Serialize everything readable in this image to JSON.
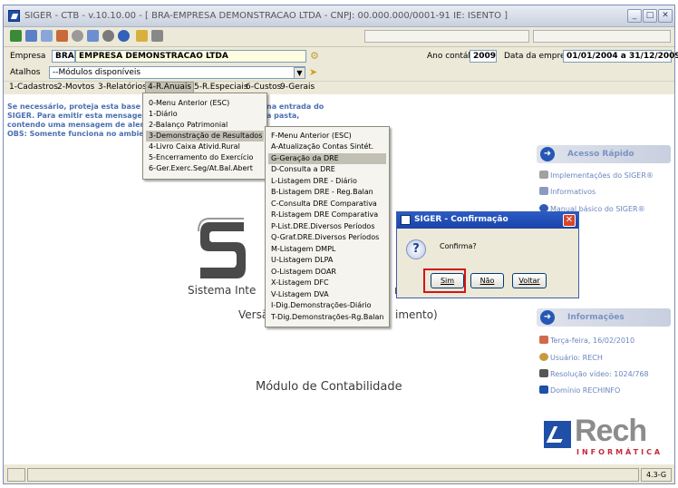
{
  "window": {
    "title": "SIGER - CTB - v.10.10.00 - [ BRA-EMPRESA DEMONSTRACAO LTDA - CNPJ: 00.000.000/0001-91 IE: ISENTO ]"
  },
  "empresa": {
    "label": "Empresa",
    "code": "BRA",
    "name": "EMPRESA DEMONSTRACAO LTDA",
    "ano_label": "Ano contábil",
    "ano_value": "2009",
    "data_label": "Data da empresa",
    "data_value": "01/01/2004 a 31/12/2009"
  },
  "atalhos": {
    "label": "Atalhos",
    "value": "--Módulos disponíveis"
  },
  "menubar": [
    "1-Cadastros",
    "2-Movtos",
    "3-Relatórios",
    "4-R.Anuais",
    "5-R.Especiais",
    "6-Custos",
    "9-Gerais"
  ],
  "warning": {
    "line1a": "Se necessário, proteja esta base de",
    "line1b": "na entrada do",
    "line2a": "SIGER. Para emitir esta mensagem,",
    "line2b": "a pasta,",
    "line3a": "contendo uma mensagem de alerta",
    "line4a": "OBS: Somente funciona no ambiente"
  },
  "menu_anuais": [
    "0-Menu Anterior (ESC)",
    "1-Diário",
    "2-Balanço Patrimonial",
    "3-Demonstração de Resultados",
    "4-Livro Caixa Ativid.Rural",
    "5-Encerramento do Exercício",
    "6-Ger.Exerc.Seg/At.Bal.Abert"
  ],
  "menu_dre": [
    "F-Menu Anterior (ESC)",
    "A-Atualização Contas Sintét.",
    "G-Geração da DRE",
    "D-Consulta a DRE",
    "L-Listagem DRE - Diário",
    "B-Listagem DRE - Reg.Balan",
    "C-Consulta DRE Comparativa",
    "R-Listagem DRE Comparativa",
    "P-List.DRE.Diversos Períodos",
    "Q-Graf.DRE.Diversos Períodos",
    "M-Listagem DMPL",
    "U-Listagem DLPA",
    "O-Listagem DOAR",
    "X-Listagem DFC",
    "V-Listagem DVA",
    "I-Dig.Demonstrações-Diário",
    "T-Dig.Demonstrações-Rg.Balan"
  ],
  "logo": {
    "system": "Sistema Inte",
    "system_tail": "n",
    "version": "Versã",
    "version_tail": "imento)",
    "module": "Módulo de Contabilidade"
  },
  "side": {
    "quick_title": "Acesso Rápido",
    "quick_links": [
      "Implementações do SIGER®",
      "Informativos",
      "Manual básico do SIGER®"
    ],
    "info_title": "Informações",
    "info_items": [
      "Terça-feira, 16/02/2010",
      "Usuário: RECH",
      "Resolução vídeo: 1024/768",
      "Domínio RECHINFO"
    ]
  },
  "brand": {
    "name": "Rech",
    "sub": "INFORMÁTICA"
  },
  "dialog": {
    "title": "SIGER - Confirmação",
    "message": "Confirma?",
    "btn_yes": "Sim",
    "btn_no": "Não",
    "btn_back": "Voltar"
  },
  "status": {
    "version": "4.3-G"
  },
  "colors": {
    "titlebar": "#2b5bc6",
    "accent_red": "#d4141a",
    "brand_blue": "#1f4fa7",
    "brand_red": "#c8283a"
  }
}
